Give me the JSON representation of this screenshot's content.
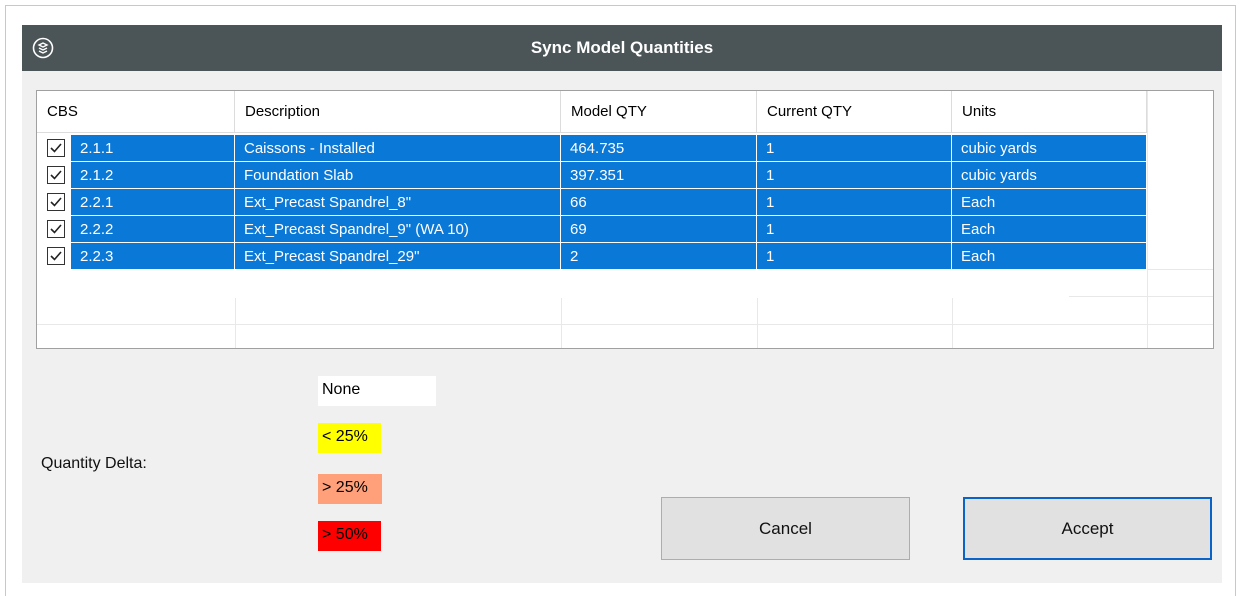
{
  "window": {
    "title": "Sync Model Quantities",
    "logo_icon": "app-logo-icon"
  },
  "table": {
    "columns": [
      "CBS",
      "Description",
      "Model QTY",
      "Current QTY",
      "Units"
    ],
    "rows": [
      {
        "checked": true,
        "cbs": "2.1.1",
        "description": "Caissons - Installed",
        "model_qty": "464.735",
        "current_qty": "1",
        "units": "cubic yards"
      },
      {
        "checked": true,
        "cbs": "2.1.2",
        "description": "Foundation Slab",
        "model_qty": "397.351",
        "current_qty": "1",
        "units": "cubic yards"
      },
      {
        "checked": true,
        "cbs": "2.2.1",
        "description": "Ext_Precast Spandrel_8\"",
        "model_qty": "66",
        "current_qty": "1",
        "units": "Each"
      },
      {
        "checked": true,
        "cbs": "2.2.2",
        "description": "Ext_Precast Spandrel_9\" (WA 10)",
        "model_qty": "69",
        "current_qty": "1",
        "units": "Each"
      },
      {
        "checked": true,
        "cbs": "2.2.3",
        "description": "Ext_Precast Spandrel_29\"",
        "model_qty": "2",
        "current_qty": "1",
        "units": "Each"
      }
    ],
    "selection_color": "#0a78d7"
  },
  "legend": {
    "label": "Quantity Delta:",
    "items": [
      {
        "text": "None",
        "color": "#ffffff"
      },
      {
        "text": "< 25%",
        "color": "#ffff00"
      },
      {
        "text": "> 25%",
        "color": "#ffa07a"
      },
      {
        "text": "> 50%",
        "color": "#ff0000"
      }
    ]
  },
  "buttons": {
    "cancel": "Cancel",
    "accept": "Accept"
  }
}
